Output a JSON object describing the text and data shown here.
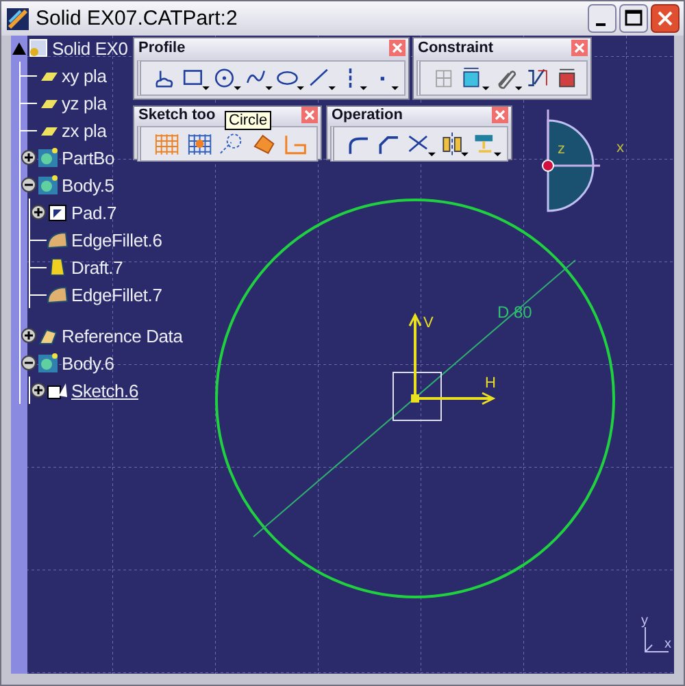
{
  "window": {
    "title": "Solid EX07.CATPart:2"
  },
  "tree": [
    {
      "label": "Solid EX0",
      "kind": "part",
      "expanded": true,
      "active": false,
      "children": [
        {
          "label": "xy pla",
          "kind": "plane",
          "active": false
        },
        {
          "label": "yz pla",
          "kind": "plane",
          "active": false
        },
        {
          "label": "zx pla",
          "kind": "plane",
          "active": false
        },
        {
          "label": "PartBo",
          "kind": "body",
          "expanded": false,
          "active": false
        },
        {
          "label": "Body.5",
          "kind": "body",
          "expanded": true,
          "active": false,
          "children": [
            {
              "label": "Pad.7",
              "kind": "pad",
              "expanded": false,
              "active": false
            },
            {
              "label": "EdgeFillet.6",
              "kind": "fillet",
              "active": false
            },
            {
              "label": "Draft.7",
              "kind": "draft",
              "active": false
            },
            {
              "label": "EdgeFillet.7",
              "kind": "fillet",
              "active": false
            }
          ]
        },
        {
          "label": "Reference Data",
          "kind": "reference",
          "expanded": false,
          "active": false
        },
        {
          "label": "Body.6",
          "kind": "body",
          "expanded": true,
          "active": false,
          "children": [
            {
              "label": "Sketch.6",
              "kind": "sketch",
              "expanded": false,
              "active": true
            }
          ]
        }
      ]
    }
  ],
  "toolbars": [
    {
      "title": "Profile",
      "kind": "profile"
    },
    {
      "title": "Constraint",
      "kind": "constraint"
    },
    {
      "title": "Sketch too",
      "kind": "sketch-tools"
    },
    {
      "title": "Operation",
      "kind": "operation"
    }
  ],
  "tooltip": "Circle",
  "canvas": {
    "dimension": "D 80",
    "axis_labels": [
      "V",
      "H"
    ],
    "compass_labels": [
      "z",
      "x"
    ],
    "corner_axis_labels": [
      "y",
      "x"
    ]
  }
}
